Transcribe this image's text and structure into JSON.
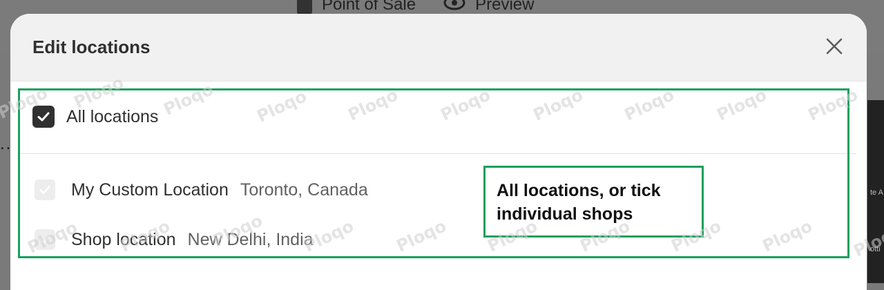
{
  "background": {
    "nav_items": [
      {
        "label": "Point of Sale",
        "icon": "shopping-bag-icon"
      },
      {
        "label": "Preview",
        "icon": "eye-icon"
      }
    ],
    "left_text": "...",
    "right_text_1": "te A",
    "right_text_2": "otti"
  },
  "modal": {
    "title": "Edit locations",
    "close_icon": "close-icon",
    "all_locations": {
      "label": "All locations",
      "checked": true
    },
    "locations": [
      {
        "name": "My Custom Location",
        "place": "Toronto, Canada",
        "checked": true,
        "disabled": true
      },
      {
        "name": "Shop location",
        "place": "New Delhi, India",
        "checked": true,
        "disabled": true
      }
    ]
  },
  "annotation": {
    "text": "All locations, or tick individual shops",
    "color": "#17a05d"
  },
  "watermark": "Ploqo"
}
